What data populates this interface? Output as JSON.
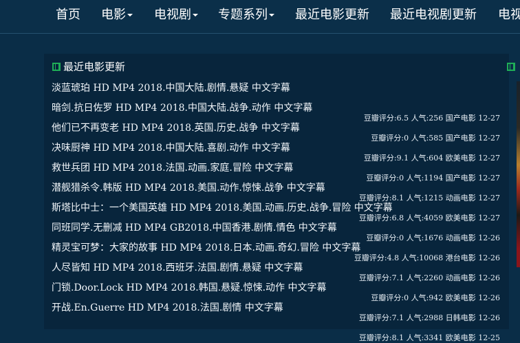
{
  "nav": {
    "items": [
      {
        "label": "首页",
        "dropdown": false
      },
      {
        "label": "电影",
        "dropdown": true
      },
      {
        "label": "电视剧",
        "dropdown": true
      },
      {
        "label": "专题系列",
        "dropdown": true
      },
      {
        "label": "最近电影更新",
        "dropdown": false
      },
      {
        "label": "最近电视剧更新",
        "dropdown": false
      },
      {
        "label": "电视",
        "dropdown": false
      }
    ]
  },
  "panel": {
    "title": "最近电影更新",
    "icon": "film-icon",
    "movies": [
      {
        "title": "淡蓝琥珀 HD MP4 2018.中国大陆.剧情.悬疑 中文字幕",
        "meta": ""
      },
      {
        "title": "暗剑.抗日佐罗 HD MP4 2018.中国大陆.战争.动作 中文字幕",
        "meta": "豆瓣评分:6.5 人气:256 国产电影 12-27"
      },
      {
        "title": "他们已不再变老 HD MP4 2018.英国.历史.战争 中文字幕",
        "meta": "豆瓣评分:0 人气:585 国产电影 12-27"
      },
      {
        "title": "决味厨神 HD MP4 2018.中国大陆.喜剧.动作 中文字幕",
        "meta": "豆瓣评分:9.1 人气:604 欧美电影 12-27"
      },
      {
        "title": "救世兵团 HD MP4 2018.法国.动画.家庭.冒险 中文字幕",
        "meta": "豆瓣评分:0 人气:1194 国产电影 12-27"
      },
      {
        "title": "潜舰猎杀令.韩版 HD MP4 2018.美国.动作.惊悚.战争 中文字幕",
        "meta": "豆瓣评分:8.1 人气:1215 动画电影 12-27"
      },
      {
        "title": "斯塔比中士：一个美国英雄 HD MP4 2018.美国.动画.历史.战争.冒险 中文字幕",
        "meta": "豆瓣评分:6.8 人气:4059 欧美电影 12-27"
      },
      {
        "title": "同班同学.无删减 HD MP4 GB2018.中国香港.剧情.情色 中文字幕",
        "meta": "豆瓣评分:0 人气:1676 动画电影 12-26"
      },
      {
        "title": "精灵宝可梦：大家的故事 HD MP4 2018.日本.动画.奇幻.冒险 中文字幕",
        "meta": "豆瓣评分:4.8 人气:10068 港台电影 12-26"
      },
      {
        "title": "人尽皆知 HD MP4 2018.西班牙.法国.剧情.悬疑 中文字幕",
        "meta": "豆瓣评分:7.1 人气:2260 动画电影 12-26"
      },
      {
        "title": "门锁.Door.Lock HD MP4 2018.韩国.悬疑.惊悚.动作 中文字幕",
        "meta": "豆瓣评分:0 人气:942 欧美电影 12-26"
      },
      {
        "title": "开战.En.Guerre HD MP4 2018.法国.剧情 中文字幕",
        "meta": "豆瓣评分:7.1 人气:2988 日韩电影 12-26"
      },
      {
        "title": "",
        "meta": "豆瓣评分:8.1 人气:3341 欧美电影 12-25"
      }
    ]
  },
  "right_panel": {
    "icon": "film-icon"
  }
}
